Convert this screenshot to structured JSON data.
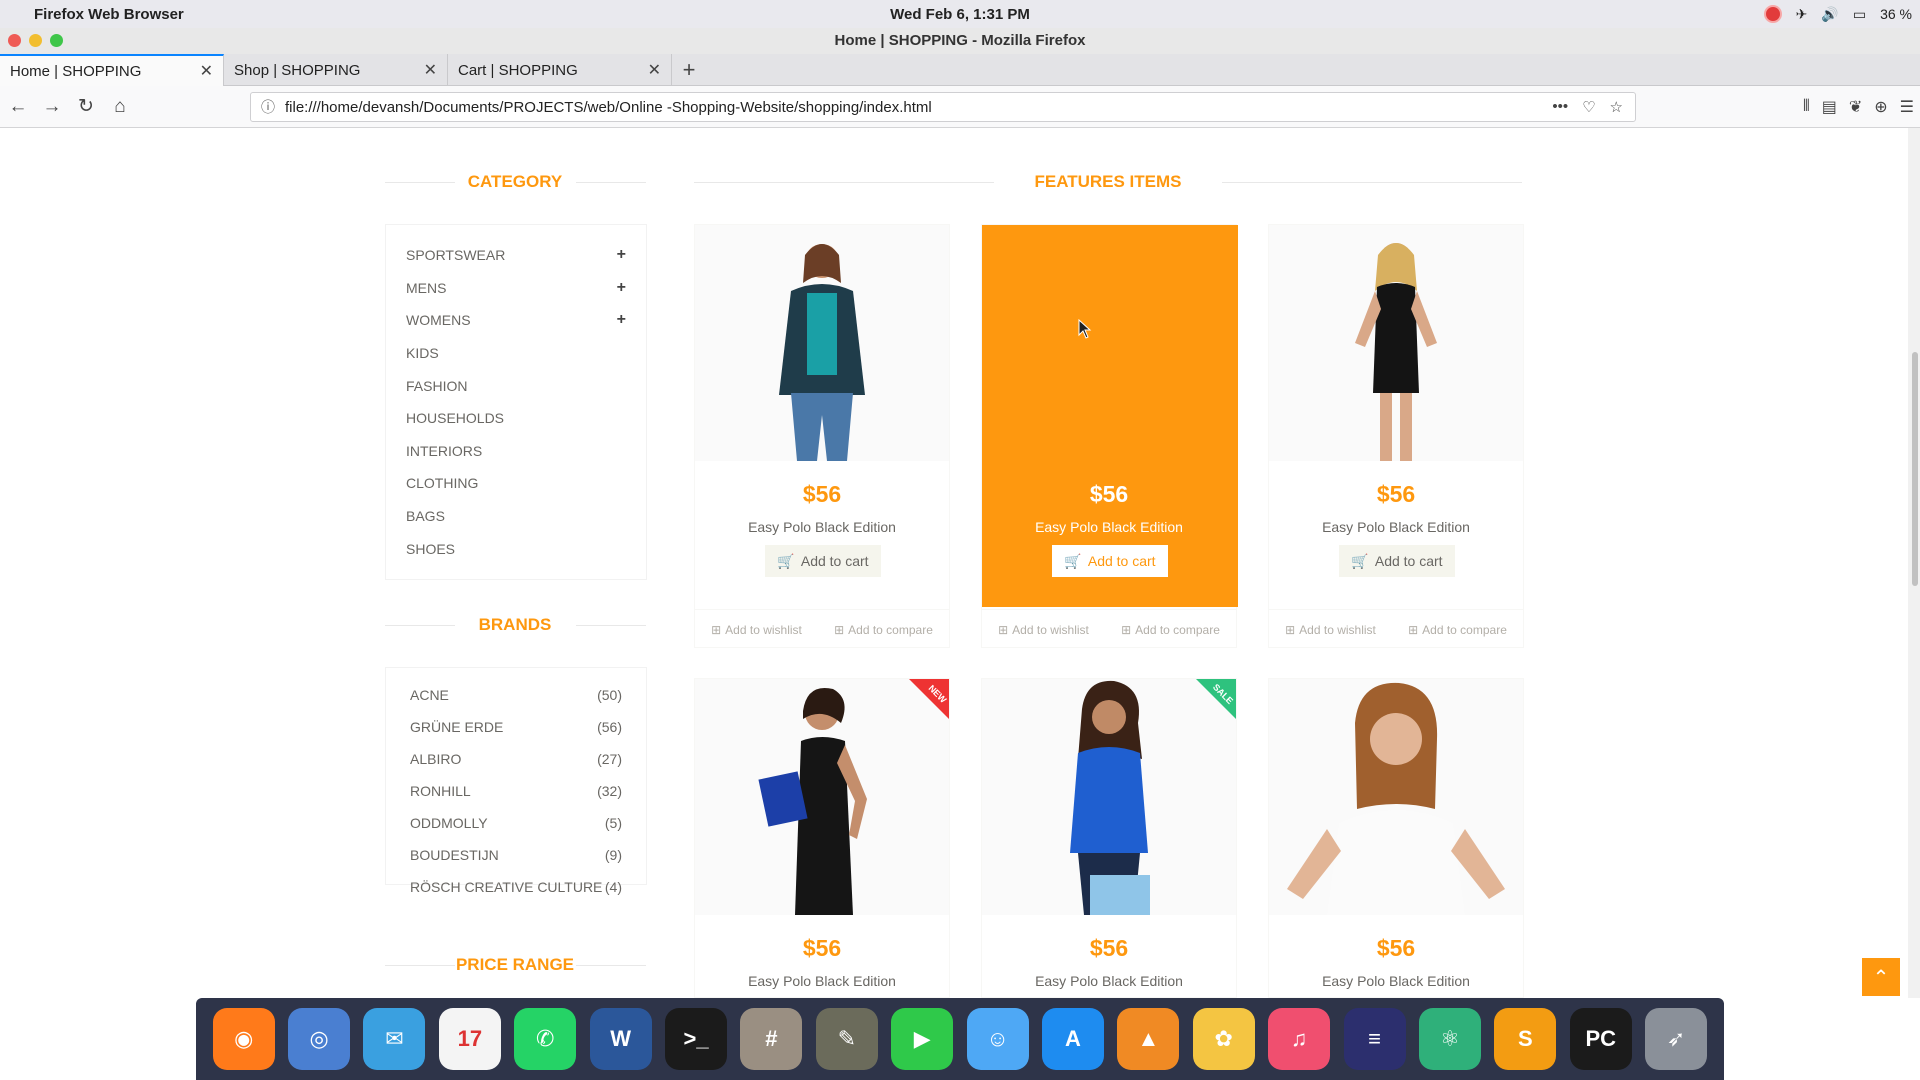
{
  "os": {
    "app_name": "Firefox Web Browser",
    "clock": "Wed Feb  6,  1:31 PM",
    "battery": "36 %"
  },
  "window": {
    "title": "Home | SHOPPING - Mozilla Firefox"
  },
  "tabs": [
    {
      "label": "Home | SHOPPING"
    },
    {
      "label": "Shop | SHOPPING"
    },
    {
      "label": "Cart | SHOPPING"
    }
  ],
  "urlbar": {
    "url": "file:///home/devansh/Documents/PROJECTS/web/Online -Shopping-Website/shopping/index.html"
  },
  "sidebar": {
    "category_title": "CATEGORY",
    "categories": [
      {
        "label": "SPORTSWEAR",
        "expand": "+"
      },
      {
        "label": "MENS",
        "expand": "+"
      },
      {
        "label": "WOMENS",
        "expand": "+"
      },
      {
        "label": "KIDS"
      },
      {
        "label": "FASHION"
      },
      {
        "label": "HOUSEHOLDS"
      },
      {
        "label": "INTERIORS"
      },
      {
        "label": "CLOTHING"
      },
      {
        "label": "BAGS"
      },
      {
        "label": "SHOES"
      }
    ],
    "brands_title": "BRANDS",
    "brands": [
      {
        "label": "ACNE",
        "count": "(50)"
      },
      {
        "label": "GRÜNE ERDE",
        "count": "(56)"
      },
      {
        "label": "ALBIRO",
        "count": "(27)"
      },
      {
        "label": "RONHILL",
        "count": "(32)"
      },
      {
        "label": "ODDMOLLY",
        "count": "(5)"
      },
      {
        "label": "BOUDESTIJN",
        "count": "(9)"
      },
      {
        "label": "RÖSCH CREATIVE CULTURE",
        "count": "(4)"
      }
    ],
    "price_title": "PRICE RANGE"
  },
  "features": {
    "title": "FEATURES ITEMS",
    "products": [
      {
        "price": "$56",
        "name": "Easy Polo Black Edition",
        "cart": "Add to cart",
        "wishlist": "Add to wishlist",
        "compare": "Add to compare"
      },
      {
        "price": "$56",
        "name": "Easy Polo Black Edition",
        "cart": "Add to cart",
        "wishlist": "Add to wishlist",
        "compare": "Add to compare"
      },
      {
        "price": "$56",
        "name": "Easy Polo Black Edition",
        "cart": "Add to cart",
        "wishlist": "Add to wishlist",
        "compare": "Add to compare"
      },
      {
        "price": "$56",
        "name": "Easy Polo Black Edition",
        "badge": "NEW"
      },
      {
        "price": "$56",
        "name": "Easy Polo Black Edition",
        "badge": "SALE"
      },
      {
        "price": "$56",
        "name": "Easy Polo Black Edition"
      }
    ]
  },
  "colors": {
    "accent": "#fe980f",
    "text": "#696763"
  },
  "dock": [
    {
      "name": "firefox-icon",
      "color": "#ff7a1a",
      "glyph": "◉"
    },
    {
      "name": "chromium-icon",
      "color": "#4a7fd1",
      "glyph": "◎"
    },
    {
      "name": "mail-icon",
      "color": "#3aa0e0",
      "glyph": "✉"
    },
    {
      "name": "calendar-icon",
      "color": "#f4f4f4",
      "glyph": "17"
    },
    {
      "name": "whatsapp-icon",
      "color": "#25d366",
      "glyph": "✆"
    },
    {
      "name": "word-icon",
      "color": "#2b579a",
      "glyph": "W"
    },
    {
      "name": "terminal-icon",
      "color": "#1b1b1b",
      "glyph": ">_"
    },
    {
      "name": "calculator-icon",
      "color": "#9a8f82",
      "glyph": "#"
    },
    {
      "name": "gimp-icon",
      "color": "#6b6b5b",
      "glyph": "✎"
    },
    {
      "name": "facetime-icon",
      "color": "#2fc94a",
      "glyph": "▶"
    },
    {
      "name": "finder-icon",
      "color": "#4ea8f5",
      "glyph": "☺"
    },
    {
      "name": "appstore-icon",
      "color": "#1e8cf0",
      "glyph": "A"
    },
    {
      "name": "vlc-icon",
      "color": "#f08a24",
      "glyph": "▲"
    },
    {
      "name": "photos-icon",
      "color": "#f4c542",
      "glyph": "✿"
    },
    {
      "name": "music-icon",
      "color": "#f04f6f",
      "glyph": "♫"
    },
    {
      "name": "eclipse-icon",
      "color": "#2c2f6e",
      "glyph": "≡"
    },
    {
      "name": "atom-icon",
      "color": "#2fb07a",
      "glyph": "⚛"
    },
    {
      "name": "sublime-icon",
      "color": "#f39c12",
      "glyph": "S"
    },
    {
      "name": "pycharm-icon",
      "color": "#1b1b1b",
      "glyph": "PC"
    },
    {
      "name": "launchpad-icon",
      "color": "#8a9099",
      "glyph": "➶"
    }
  ]
}
